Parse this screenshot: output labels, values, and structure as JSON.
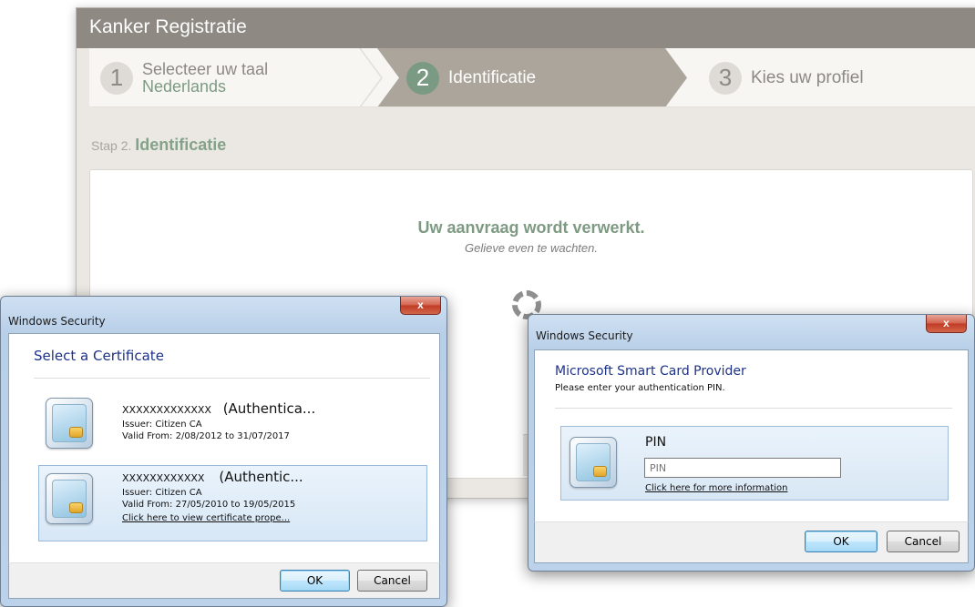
{
  "app": {
    "title": "Kanker Registratie",
    "steps": [
      {
        "number": "1",
        "label": "Selecteer uw taal",
        "value": "Nederlands"
      },
      {
        "number": "2",
        "label": "Identificatie"
      },
      {
        "number": "3",
        "label": "Kies uw profiel"
      }
    ],
    "step_heading_prefix": "Stap 2.",
    "step_heading": "Identificatie",
    "message_title": "Uw aanvraag wordt verwerkt.",
    "message_subtitle": "Gelieve even te wachten."
  },
  "cert_dialog": {
    "window_title": "Windows Security",
    "heading": "Select a Certificate",
    "certificates": [
      {
        "name": "XXXXXXXXXXXXX",
        "purpose": "(Authentica...",
        "issuer": "Issuer: Citizen CA",
        "valid": "Valid From: 2/08/2012 to 31/07/2017"
      },
      {
        "name": "XXXXXXXXXXXX",
        "purpose": "(Authentic...",
        "issuer": "Issuer: Citizen CA",
        "valid": "Valid From: 27/05/2010 to 19/05/2015",
        "link": "Click here to view certificate prope..."
      }
    ],
    "ok_label": "OK",
    "cancel_label": "Cancel",
    "close_label": "x"
  },
  "pin_dialog": {
    "window_title": "Windows Security",
    "heading": "Microsoft Smart Card Provider",
    "instruction": "Please enter your authentication PIN.",
    "pin_label": "PIN",
    "pin_placeholder": "PIN",
    "info_link": "Click here for more information",
    "ok_label": "OK",
    "cancel_label": "Cancel",
    "close_label": "x"
  }
}
